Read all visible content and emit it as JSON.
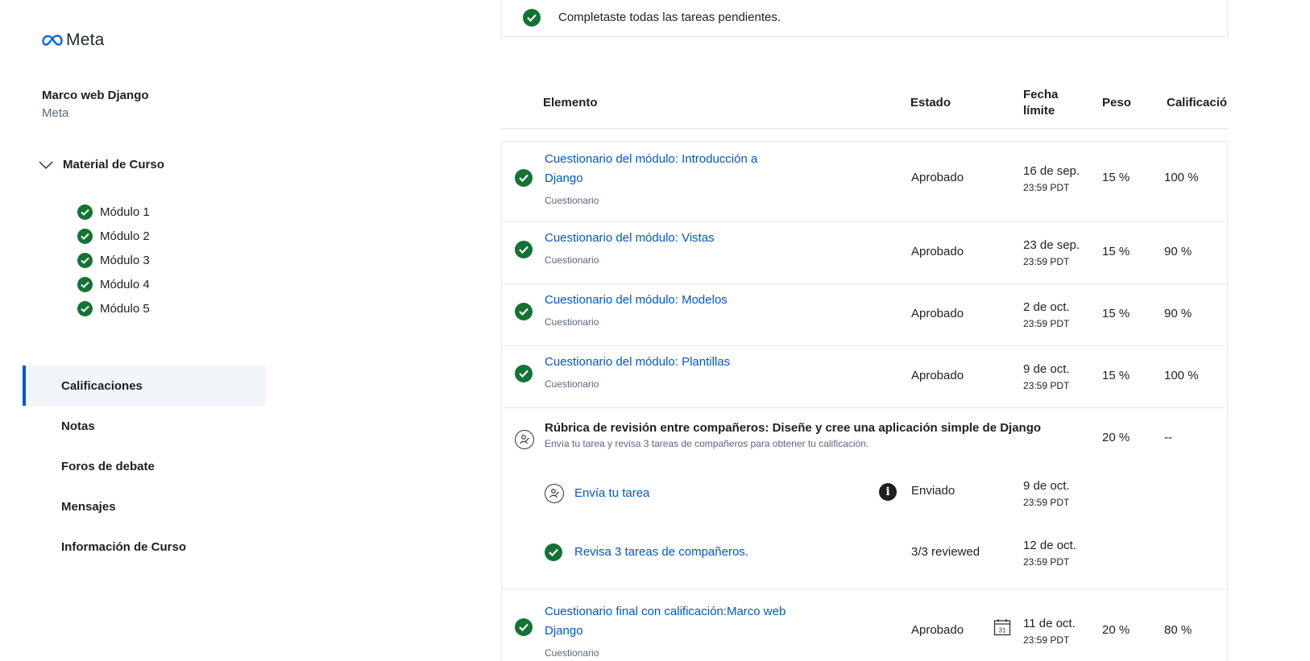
{
  "sidebar": {
    "logo_text": "Meta",
    "course_title": "Marco web Django",
    "course_partner": "Meta",
    "material_label": "Material de Curso",
    "modules": [
      {
        "label": "Módulo 1"
      },
      {
        "label": "Módulo 2"
      },
      {
        "label": "Módulo 3"
      },
      {
        "label": "Módulo 4"
      },
      {
        "label": "Módulo 5"
      }
    ],
    "nav": [
      {
        "label": "Calificaciones",
        "active": true
      },
      {
        "label": "Notas"
      },
      {
        "label": "Foros de debate"
      },
      {
        "label": "Mensajes"
      },
      {
        "label": "Información de Curso"
      }
    ]
  },
  "banner": {
    "text": "Completaste todas las tareas pendientes."
  },
  "table": {
    "headers": {
      "item": "Elemento",
      "status": "Estado",
      "due_line1": "Fecha",
      "due_line2": "límite",
      "weight": "Peso",
      "grade": "Calificación"
    },
    "rows": [
      {
        "title": "Cuestionario del módulo: Introducción a Django",
        "type": "Cuestionario",
        "status": "Aprobado",
        "due_date": "16 de sep.",
        "due_time": "23:59 PDT",
        "weight": "15 %",
        "grade": "100 %"
      },
      {
        "title": "Cuestionario del módulo: Vistas",
        "type": "Cuestionario",
        "status": "Aprobado",
        "due_date": "23 de sep.",
        "due_time": "23:59 PDT",
        "weight": "15 %",
        "grade": "90 %"
      },
      {
        "title": "Cuestionario del módulo: Modelos",
        "type": "Cuestionario",
        "status": "Aprobado",
        "due_date": "2 de oct.",
        "due_time": "23:59 PDT",
        "weight": "15 %",
        "grade": "90 %"
      },
      {
        "title": "Cuestionario del módulo: Plantillas",
        "type": "Cuestionario",
        "status": "Aprobado",
        "due_date": "9 de oct.",
        "due_time": "23:59 PDT",
        "weight": "15 %",
        "grade": "100 %"
      }
    ],
    "peer": {
      "title": "Rúbrica de revisión entre compañeros: Diseñe y cree una aplicación simple de Django",
      "description": "Envía tu tarea y revisa 3 tareas de compañeros para obtener tu calificación.",
      "weight": "20 %",
      "grade": "--",
      "submit": {
        "label": "Envía tu tarea",
        "status": "Enviado",
        "due_date": "9 de oct.",
        "due_time": "23:59 PDT"
      },
      "review": {
        "label": "Revisa 3 tareas de compañeros.",
        "status": "3/3 reviewed",
        "due_date": "12 de oct.",
        "due_time": "23:59 PDT"
      }
    },
    "final": {
      "title": "Cuestionario final con calificación:Marco web Django",
      "type": "Cuestionario",
      "status": "Aprobado",
      "calendar_day": "31",
      "due_date": "11 de oct.",
      "due_time": "23:59 PDT",
      "weight": "20 %",
      "grade": "80 %"
    }
  },
  "colors": {
    "success": "#137333",
    "link": "#0056d2",
    "active_bg": "#f2f5fa",
    "active_border": "#0056d2"
  }
}
